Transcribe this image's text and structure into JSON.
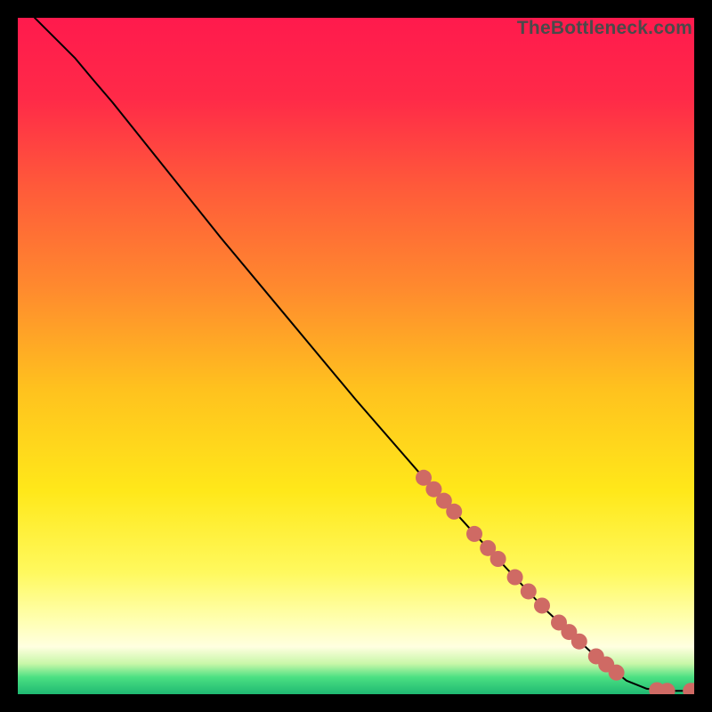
{
  "watermark": "TheBottleneck.com",
  "chart_data": {
    "type": "line",
    "title": "",
    "xlabel": "",
    "ylabel": "",
    "xlim": [
      0,
      100
    ],
    "ylim": [
      0,
      100
    ],
    "gradient_stops": [
      {
        "offset": 0.0,
        "color": "#ff1a4d"
      },
      {
        "offset": 0.12,
        "color": "#ff2a48"
      },
      {
        "offset": 0.25,
        "color": "#ff5a3a"
      },
      {
        "offset": 0.4,
        "color": "#ff8a2e"
      },
      {
        "offset": 0.55,
        "color": "#ffc21e"
      },
      {
        "offset": 0.7,
        "color": "#ffe81a"
      },
      {
        "offset": 0.82,
        "color": "#fff95e"
      },
      {
        "offset": 0.89,
        "color": "#ffffb0"
      },
      {
        "offset": 0.93,
        "color": "#ffffe0"
      },
      {
        "offset": 0.955,
        "color": "#c8f7a8"
      },
      {
        "offset": 0.975,
        "color": "#4be082"
      },
      {
        "offset": 1.0,
        "color": "#1fb872"
      }
    ],
    "curve": [
      {
        "x": 2.5,
        "y": 100.0
      },
      {
        "x": 4.0,
        "y": 98.5
      },
      {
        "x": 6.0,
        "y": 96.5
      },
      {
        "x": 8.5,
        "y": 94.0
      },
      {
        "x": 11.0,
        "y": 91.0
      },
      {
        "x": 14.0,
        "y": 87.5
      },
      {
        "x": 20.0,
        "y": 80.0
      },
      {
        "x": 30.0,
        "y": 67.5
      },
      {
        "x": 40.0,
        "y": 55.5
      },
      {
        "x": 50.0,
        "y": 43.5
      },
      {
        "x": 60.0,
        "y": 32.0
      },
      {
        "x": 70.0,
        "y": 21.0
      },
      {
        "x": 78.0,
        "y": 12.5
      },
      {
        "x": 85.0,
        "y": 6.0
      },
      {
        "x": 90.0,
        "y": 2.0
      },
      {
        "x": 93.0,
        "y": 0.8
      },
      {
        "x": 96.0,
        "y": 0.5
      },
      {
        "x": 100.0,
        "y": 0.5
      }
    ],
    "markers": [
      {
        "x": 60.0,
        "y": 32.0
      },
      {
        "x": 61.5,
        "y": 30.3
      },
      {
        "x": 63.0,
        "y": 28.6
      },
      {
        "x": 64.5,
        "y": 27.0
      },
      {
        "x": 67.5,
        "y": 23.7
      },
      {
        "x": 69.5,
        "y": 21.6
      },
      {
        "x": 71.0,
        "y": 20.0
      },
      {
        "x": 73.5,
        "y": 17.3
      },
      {
        "x": 75.5,
        "y": 15.2
      },
      {
        "x": 77.5,
        "y": 13.1
      },
      {
        "x": 80.0,
        "y": 10.6
      },
      {
        "x": 81.5,
        "y": 9.2
      },
      {
        "x": 83.0,
        "y": 7.8
      },
      {
        "x": 85.5,
        "y": 5.6
      },
      {
        "x": 87.0,
        "y": 4.4
      },
      {
        "x": 88.5,
        "y": 3.2
      },
      {
        "x": 94.5,
        "y": 0.6
      },
      {
        "x": 96.0,
        "y": 0.5
      },
      {
        "x": 99.5,
        "y": 0.5
      },
      {
        "x": 100.0,
        "y": 0.5
      }
    ],
    "marker_color": "#cf6a64",
    "marker_radius": 9,
    "line_color": "#000000",
    "line_width": 2
  }
}
